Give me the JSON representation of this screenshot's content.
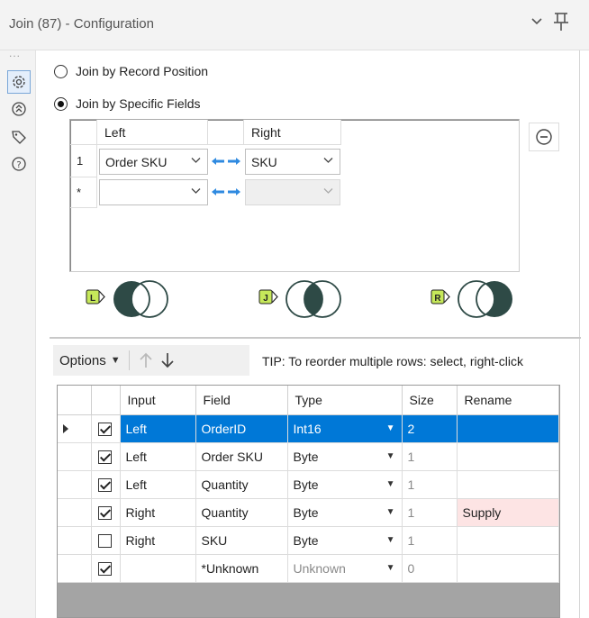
{
  "window": {
    "title": "Join (87) - Configuration",
    "collapse_icon": "chevron-down-icon",
    "pin_icon": "pin-icon"
  },
  "sidebar": {
    "dots": "...",
    "items": [
      {
        "name": "configuration",
        "icon": "gear-icon",
        "active": true
      },
      {
        "name": "connections",
        "icon": "arrows-icon",
        "active": false
      },
      {
        "name": "annotation",
        "icon": "tag-icon",
        "active": false
      },
      {
        "name": "help",
        "icon": "help-icon",
        "active": false
      }
    ]
  },
  "join_mode": {
    "by_position_label": "Join by Record Position",
    "by_fields_label": "Join by Specific Fields",
    "selected": "by_fields"
  },
  "join_fields": {
    "left_header": "Left",
    "right_header": "Right",
    "rows": [
      {
        "num": "1",
        "left": "Order SKU",
        "right": "SKU"
      },
      {
        "num": "*",
        "left": "",
        "right": ""
      }
    ]
  },
  "venn": {
    "left_badge": "L",
    "join_badge": "J",
    "right_badge": "R",
    "color": "#2e4a46"
  },
  "options": {
    "button_label": "Options",
    "tip": "TIP: To reorder multiple rows: select, right-click"
  },
  "select_grid": {
    "headers": [
      "Input",
      "Field",
      "Type",
      "Size",
      "Rename"
    ],
    "rows": [
      {
        "checked": true,
        "input": "Left",
        "field": "OrderID",
        "type": "Int16",
        "size": "2",
        "rename": "",
        "selected": true
      },
      {
        "checked": true,
        "input": "Left",
        "field": "Order SKU",
        "type": "Byte",
        "size": "1",
        "rename": ""
      },
      {
        "checked": true,
        "input": "Left",
        "field": "Quantity",
        "type": "Byte",
        "size": "1",
        "rename": ""
      },
      {
        "checked": true,
        "input": "Right",
        "field": "Quantity",
        "type": "Byte",
        "size": "1",
        "rename": "Supply"
      },
      {
        "checked": false,
        "input": "Right",
        "field": "SKU",
        "type": "Byte",
        "size": "1",
        "rename": ""
      },
      {
        "checked": true,
        "input": "",
        "field": "*Unknown",
        "type": "Unknown",
        "size": "0",
        "rename": ""
      }
    ],
    "selection_color": "#0078d7",
    "rename_highlight": "#fde4e4"
  }
}
